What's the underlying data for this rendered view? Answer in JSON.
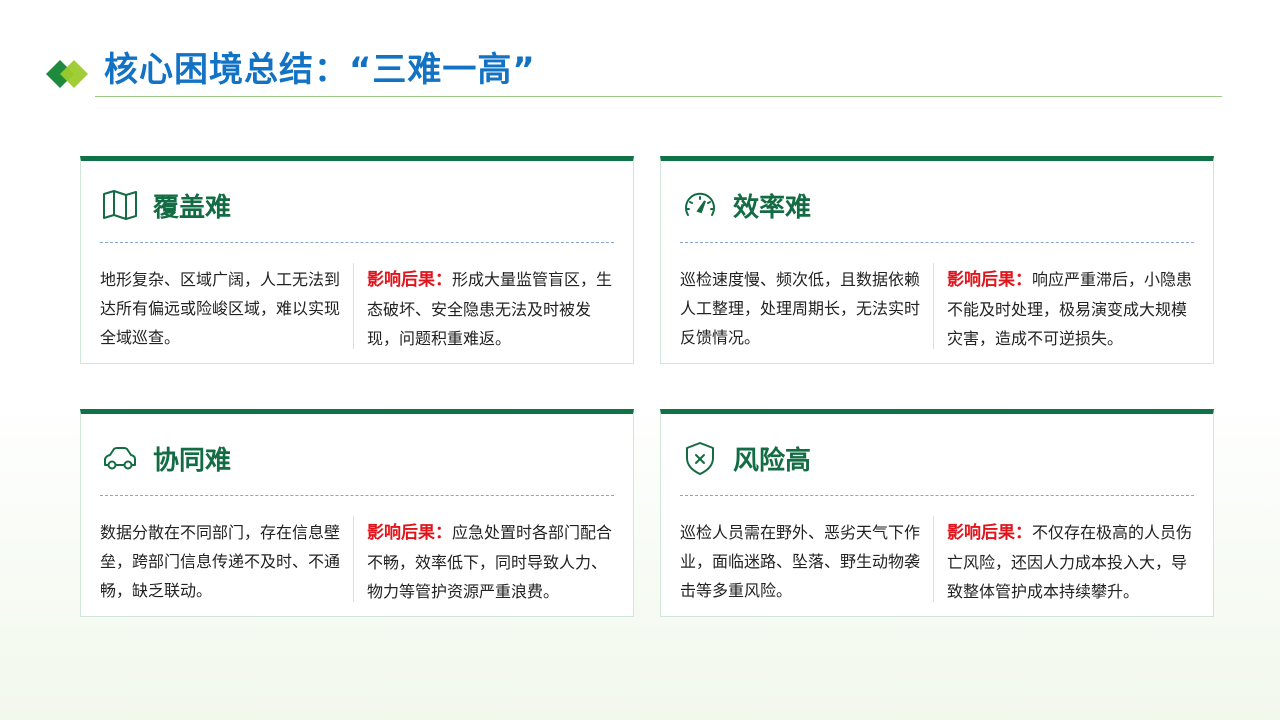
{
  "title": "核心困境总结：“三难一高”",
  "colors": {
    "title": "#1272c4",
    "card_accent": "#0f7347",
    "card_title": "#136c43",
    "impact_label": "#e1141c",
    "divider": "#8aa6c8"
  },
  "cards": [
    {
      "icon": "map-icon",
      "title": "覆盖难",
      "description": "地形复杂、区域广阔，人工无法到达所有偏远或险峻区域，难以实现全域巡查。",
      "impact_label": "影响后果：",
      "impact_text": "形成大量监管盲区，生态破坏、安全隐患无法及时被发现，问题积重难返。"
    },
    {
      "icon": "speedometer-icon",
      "title": "效率难",
      "description": "巡检速度慢、频次低，且数据依赖人工整理，处理周期长，无法实时反馈情况。",
      "impact_label": "影响后果：",
      "impact_text": "响应严重滞后，小隐患不能及时处理，极易演变成大规模灾害，造成不可逆损失。"
    },
    {
      "icon": "car-icon",
      "title": "协同难",
      "description": "数据分散在不同部门，存在信息壁垒，跨部门信息传递不及时、不通畅，缺乏联动。",
      "impact_label": "影响后果：",
      "impact_text": "应急处置时各部门配合不畅，效率低下，同时导致人力、物力等管护资源严重浪费。"
    },
    {
      "icon": "shield-x-icon",
      "title": "风险高",
      "description": "巡检人员需在野外、恶劣天气下作业，面临迷路、坠落、野生动物袭击等多重风险。",
      "impact_label": "影响后果：",
      "impact_text": "不仅存在极高的人员伤亡风险，还因人力成本投入大，导致整体管护成本持续攀升。"
    }
  ]
}
